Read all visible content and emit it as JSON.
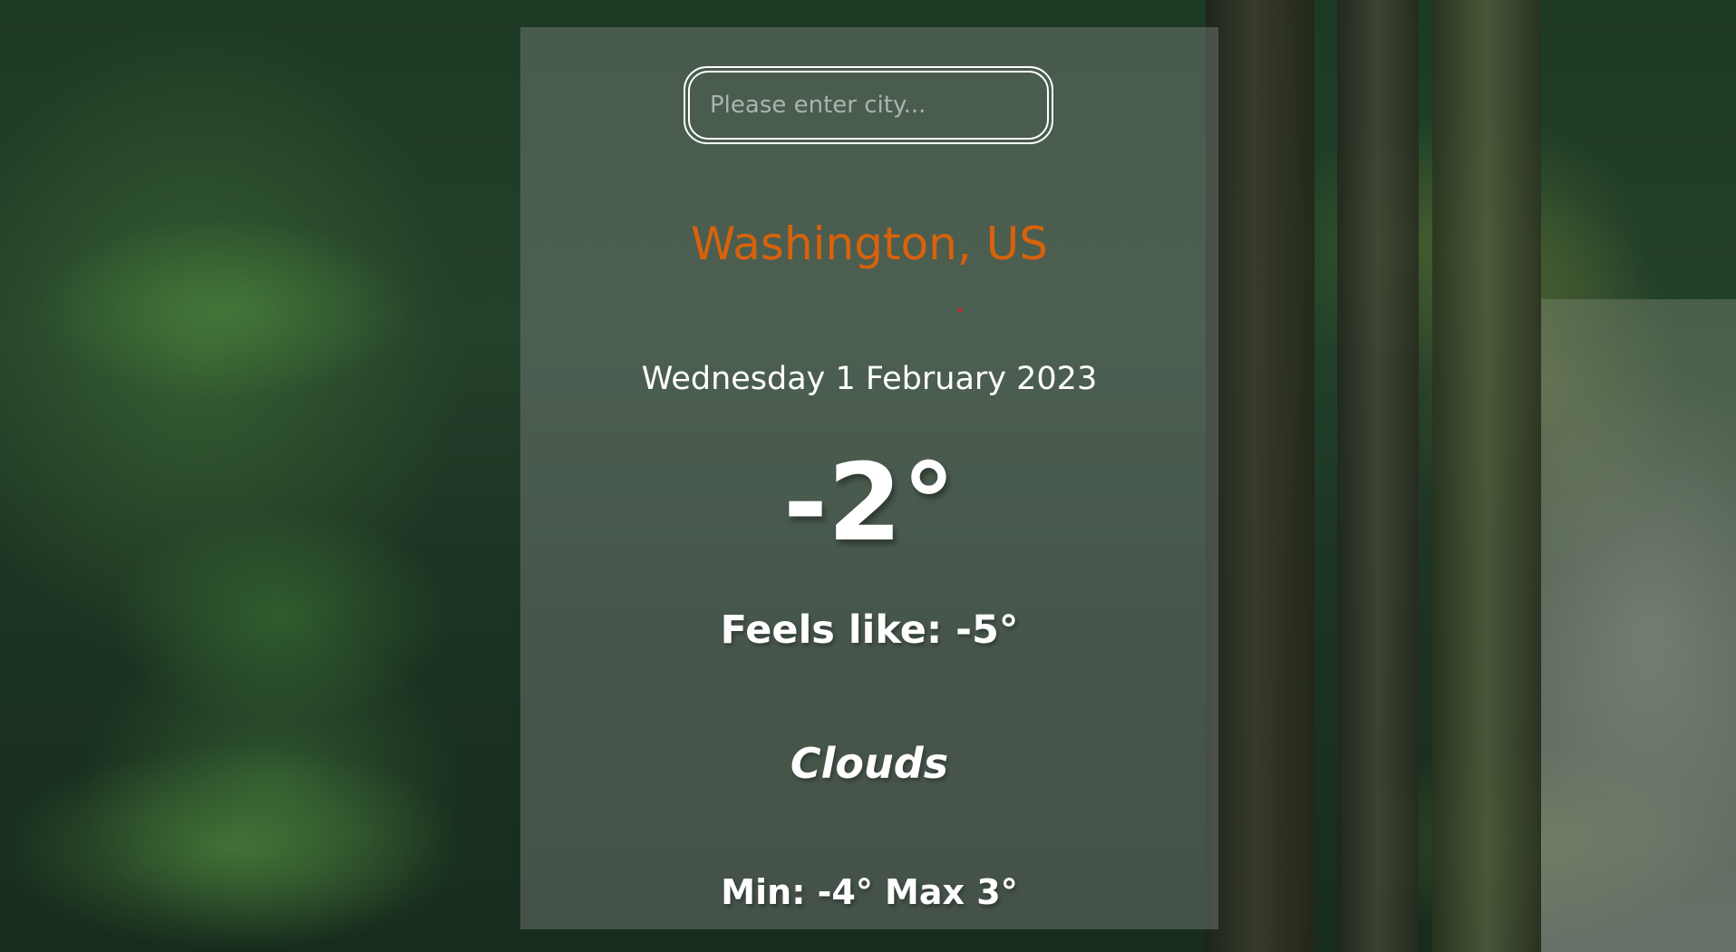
{
  "search": {
    "value": "",
    "placeholder": "Please enter city..."
  },
  "weather": {
    "location": "Washington, US",
    "date": "Wednesday 1 February 2023",
    "temperature": "-2°",
    "feels_like": "Feels like: -5°",
    "description": "Clouds",
    "min_max": "Min: -4° Max 3°"
  },
  "colors": {
    "location_text": "#d8620c",
    "card_background": "rgba(150,150,150,0.36)",
    "text": "#ffffff"
  }
}
